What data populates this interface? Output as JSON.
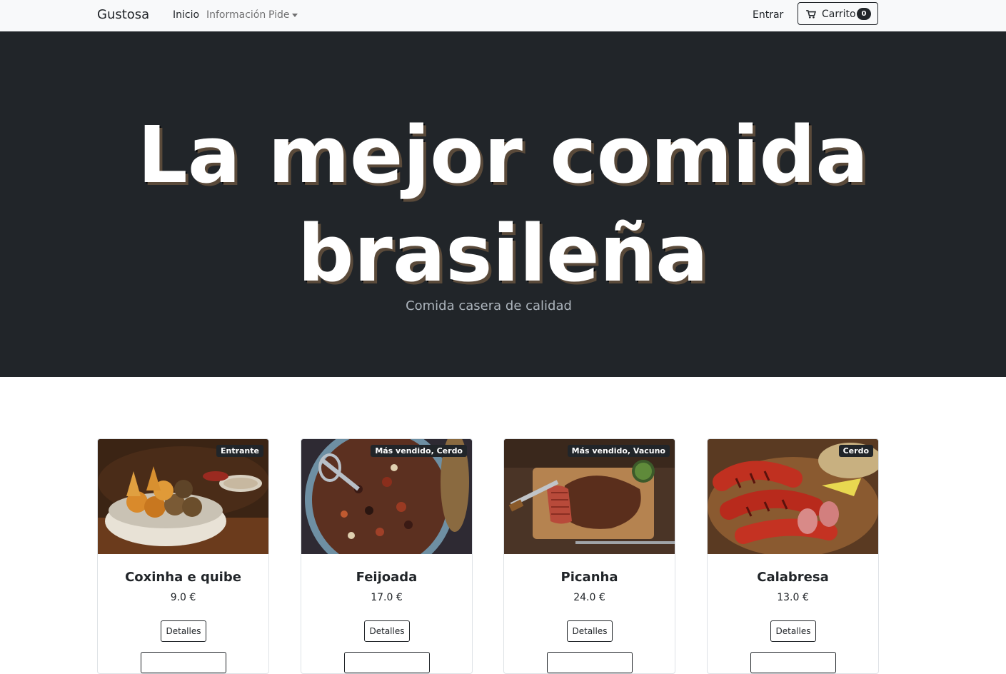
{
  "nav": {
    "brand": "Gustosa",
    "links": [
      {
        "label": "Inicio",
        "active": true
      },
      {
        "label": "Información",
        "active": false
      },
      {
        "label": "Pide",
        "active": false,
        "dropdown": true
      }
    ],
    "login": "Entrar",
    "cart": {
      "label": "Carrito",
      "count": "0",
      "icon": "cart-icon"
    }
  },
  "hero": {
    "title_line1": "La mejor comida",
    "title_line2": "brasileña",
    "subtitle": "Comida casera de calidad"
  },
  "products": [
    {
      "name": "Coxinha e quibe",
      "price": "9.0 €",
      "badge": "Entrante",
      "details": "Detalles"
    },
    {
      "name": "Feijoada",
      "price": "17.0 €",
      "badge": "Más vendido, Cerdo",
      "details": "Detalles"
    },
    {
      "name": "Picanha",
      "price": "24.0 €",
      "badge": "Más vendido, Vacuno",
      "details": "Detalles"
    },
    {
      "name": "Calabresa",
      "price": "13.0 €",
      "badge": "Cerdo",
      "details": "Detalles"
    }
  ]
}
